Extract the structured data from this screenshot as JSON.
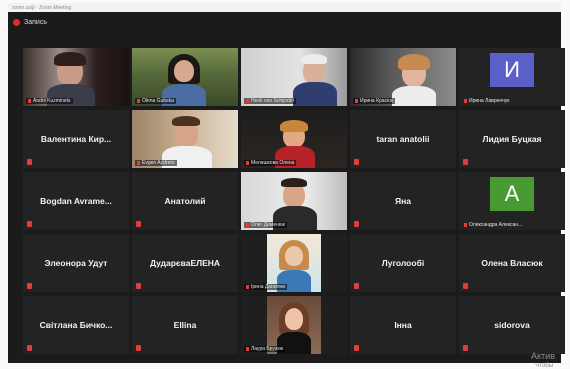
{
  "window": {
    "recording_label": "Запись",
    "top_strip_text": "zoom.us/j/ · Zoom Meeting"
  },
  "participants": [
    {
      "name": "Andrii Kuzminets",
      "has_video": true
    },
    {
      "name": "Olena Gubska",
      "has_video": true
    },
    {
      "name": "Henk van Schijndel",
      "has_video": true,
      "active": true
    },
    {
      "name": "Ирина Красюк",
      "has_video": true
    },
    {
      "name": "Ирина Лавренчук",
      "has_video": false,
      "avatar_letter": "И",
      "avatar_color": "#5b5fc7"
    },
    {
      "name": "Валентина Кир...",
      "has_video": false
    },
    {
      "name": "Evgen Azdrem",
      "has_video": true
    },
    {
      "name": "Мелешкова Олена",
      "has_video": true
    },
    {
      "name": "taran anatolii",
      "has_video": false
    },
    {
      "name": "Лидия Буцкая",
      "has_video": false
    },
    {
      "name": "Bogdan Avrame...",
      "has_video": false
    },
    {
      "name": "Анатолий",
      "has_video": false
    },
    {
      "name": "Олег Деменюк",
      "has_video": true
    },
    {
      "name": "Яна",
      "has_video": false
    },
    {
      "name": "Олександра Алексан...",
      "has_video": false,
      "avatar_letter": "A",
      "avatar_color": "#4a9a34"
    },
    {
      "name": "Элеонора Удут",
      "has_video": false
    },
    {
      "name": "ДударєваЕЛЕНА",
      "has_video": false
    },
    {
      "name": "Ірина Данилюк",
      "has_video": true
    },
    {
      "name": "Луголообі",
      "has_video": false
    },
    {
      "name": "Олена Власюк",
      "has_video": false
    },
    {
      "name": "Світлана Бичко...",
      "has_video": false
    },
    {
      "name": "Ellina",
      "has_video": false
    },
    {
      "name": "Лаура Брузюк",
      "has_video": true
    },
    {
      "name": "Інна",
      "has_video": false
    },
    {
      "name": "sidorova",
      "has_video": false
    }
  ],
  "watermark": {
    "line1": "Актив",
    "line2": "Чтобы"
  }
}
